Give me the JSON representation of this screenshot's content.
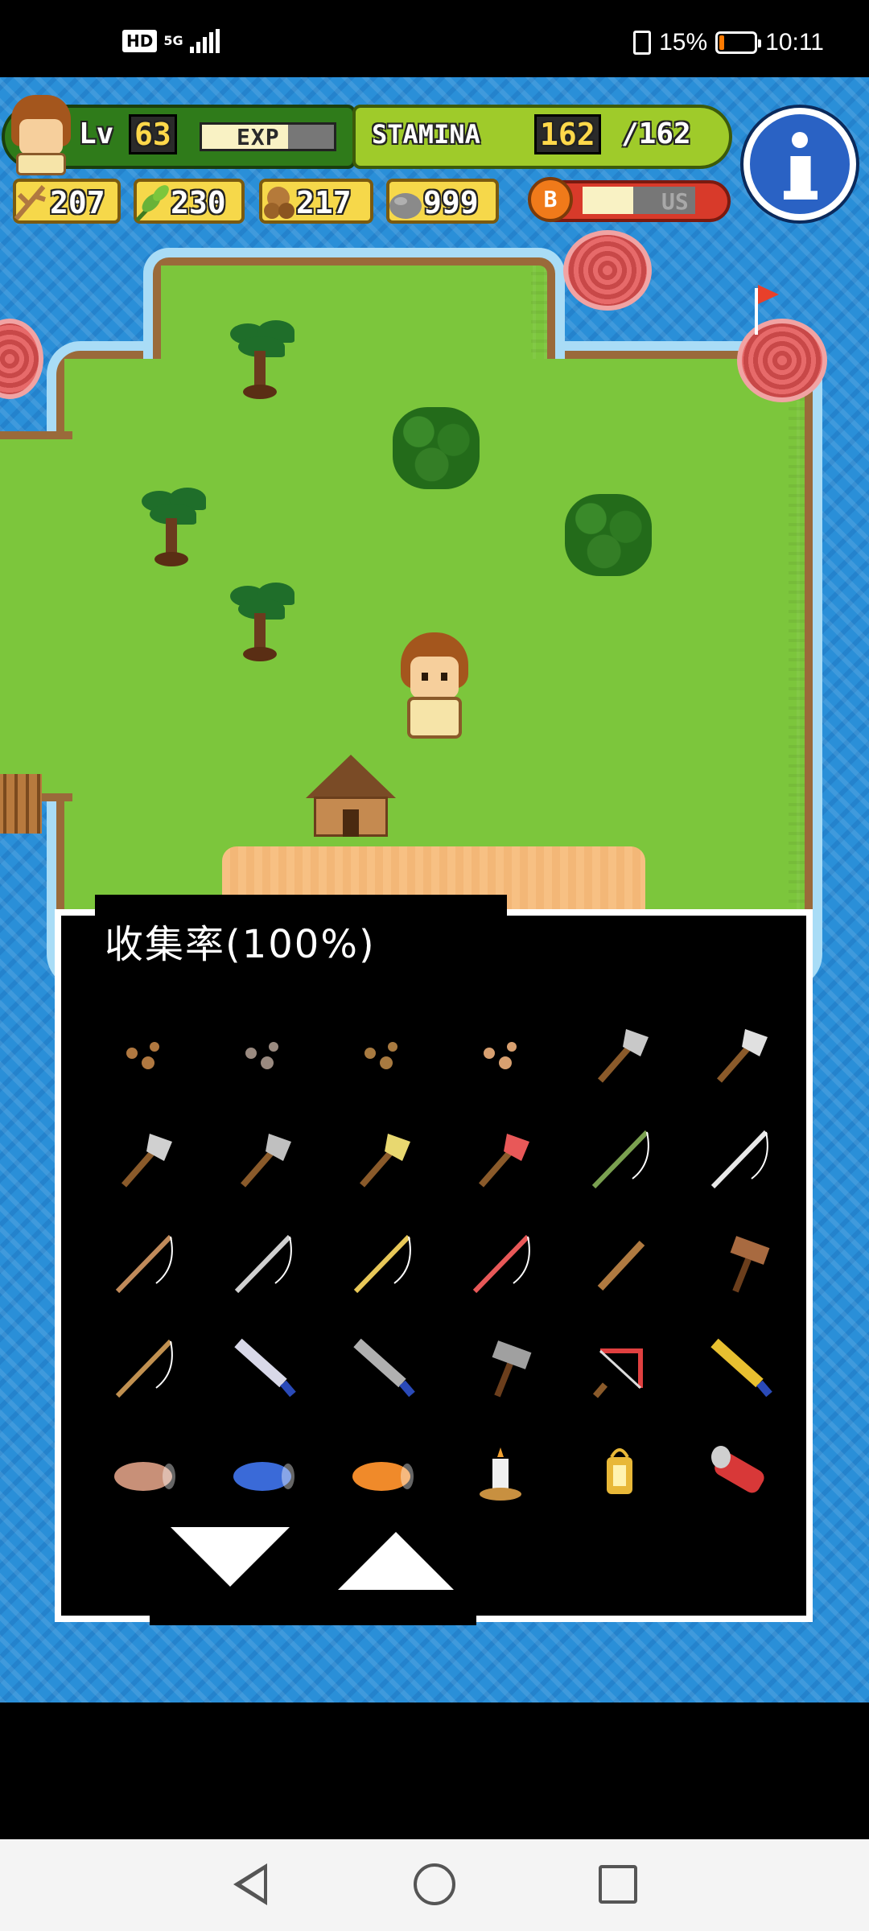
{
  "status_bar": {
    "hd_label": "HD",
    "network_label": "5G",
    "battery_percent": "15%",
    "battery_level": 0.15,
    "time": "10:11"
  },
  "hud": {
    "level_label": "Lv",
    "level_value": "63",
    "exp_label": "EXP",
    "exp_fill_percent": 65,
    "stamina_label": "STAMINA",
    "stamina_value": "162",
    "stamina_max": "/162",
    "resources": [
      {
        "icon": "branch-icon",
        "value": "207"
      },
      {
        "icon": "leaf-icon",
        "value": "230"
      },
      {
        "icon": "nut-icon",
        "value": "217"
      },
      {
        "icon": "stone-icon",
        "value": "999"
      }
    ],
    "bonus_icon_letter": "B",
    "bonus_label": "US",
    "bonus_fill_percent": 45,
    "info_button": "info-icon"
  },
  "panel": {
    "title": "收集率(100%)",
    "items": [
      {
        "name": "twig-item-icon",
        "color": "#b07840"
      },
      {
        "name": "pebbles-item-icon",
        "color": "#9a8a80"
      },
      {
        "name": "wood-chips-item-icon",
        "color": "#a87a40"
      },
      {
        "name": "ginger-root-item-icon",
        "color": "#d8a070"
      },
      {
        "name": "stone-axe-item-icon",
        "color": "#c8c8c8"
      },
      {
        "name": "iron-axe-item-icon",
        "color": "#e0e0e0"
      },
      {
        "name": "axe-item-icon",
        "color": "#d0d0d0"
      },
      {
        "name": "pickaxe-item-icon",
        "color": "#c0c0c0"
      },
      {
        "name": "golden-axe-item-icon",
        "color": "#e8d870"
      },
      {
        "name": "red-axe-item-icon",
        "color": "#e85858"
      },
      {
        "name": "vine-rope-item-icon",
        "color": "#7aa050"
      },
      {
        "name": "bow-item-icon",
        "color": "#e8e8e8"
      },
      {
        "name": "fishing-rod-item-icon",
        "color": "#c08a5a"
      },
      {
        "name": "steel-fishing-rod-item-icon",
        "color": "#d0d0d0"
      },
      {
        "name": "golden-fishing-rod-item-icon",
        "color": "#e8c858"
      },
      {
        "name": "red-crossbow-item-icon",
        "color": "#e85858"
      },
      {
        "name": "stick-item-icon",
        "color": "#b07a40"
      },
      {
        "name": "hammer-item-icon",
        "color": "#a86a40"
      },
      {
        "name": "mortar-bowl-item-icon",
        "color": "#c09050"
      },
      {
        "name": "knife-item-icon",
        "color": "#d8d8e8"
      },
      {
        "name": "cleaver-item-icon",
        "color": "#b0b0b0"
      },
      {
        "name": "iron-hammer-item-icon",
        "color": "#a0a0a0"
      },
      {
        "name": "saw-item-icon",
        "color": "#e04040"
      },
      {
        "name": "golden-cleaver-item-icon",
        "color": "#e8c030"
      },
      {
        "name": "log-item-icon",
        "color": "#c89078"
      },
      {
        "name": "blue-roll-item-icon",
        "color": "#3a6ad8"
      },
      {
        "name": "orange-roll-item-icon",
        "color": "#f08a2a"
      },
      {
        "name": "candle-item-icon",
        "color": "#f0f0f0"
      },
      {
        "name": "lantern-item-icon",
        "color": "#e8b838"
      },
      {
        "name": "flashlight-item-icon",
        "color": "#d83838"
      }
    ]
  },
  "colors": {
    "sea": "#2a8fd8",
    "grass": "#7cc63c",
    "panel_bg": "#000000",
    "panel_border": "#ffffff"
  }
}
